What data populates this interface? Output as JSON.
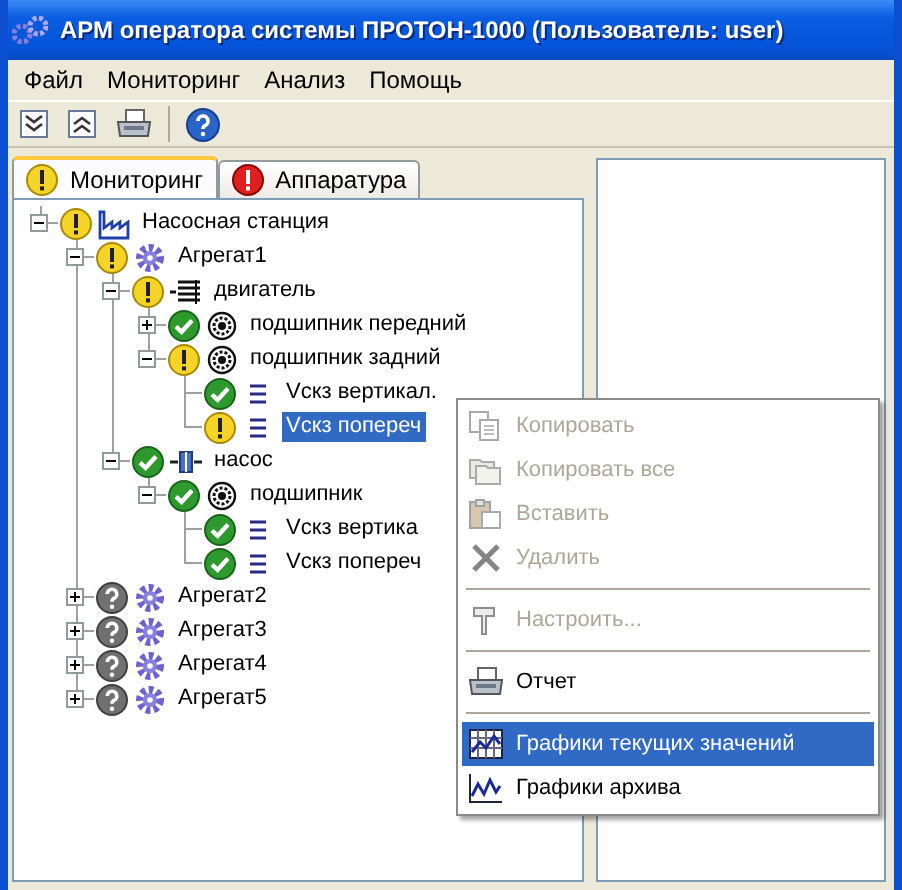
{
  "window": {
    "title": "АРМ оператора системы ПРОТОН-1000  (Пользователь: user)"
  },
  "menu": [
    "Файл",
    "Мониторинг",
    "Анализ",
    "Помощь"
  ],
  "tabs": [
    {
      "label": "Мониторинг",
      "badge": {
        "kind": "warning"
      },
      "selected": true
    },
    {
      "label": "Аппаратура",
      "badge": {
        "kind": "error"
      },
      "selected": false
    }
  ],
  "tree": {
    "items": [
      {
        "label": "Насосная станция",
        "status": {
          "kind": "warning"
        },
        "kind": "station",
        "expanded": true,
        "selected": false,
        "children": [
          {
            "label": "Агрегат1",
            "status": {
              "kind": "warning"
            },
            "kind": "unit",
            "expanded": true,
            "selected": false,
            "children": [
              {
                "label": "двигатель",
                "status": {
                  "kind": "warning"
                },
                "kind": "motor",
                "expanded": true,
                "selected": false,
                "children": [
                  {
                    "label": "подшипник передний",
                    "status": {
                      "kind": "ok"
                    },
                    "kind": "bearing",
                    "expanded": false,
                    "selected": false
                  },
                  {
                    "label": "подшипник задний",
                    "status": {
                      "kind": "warning"
                    },
                    "kind": "bearing",
                    "expanded": true,
                    "selected": false,
                    "children": [
                      {
                        "label": "Vскз вертикал.",
                        "status": {
                          "kind": "ok"
                        },
                        "kind": "sensor",
                        "selected": false
                      },
                      {
                        "label": "Vскз попереч",
                        "status": {
                          "kind": "warning"
                        },
                        "kind": "sensor",
                        "selected": true
                      }
                    ]
                  }
                ]
              },
              {
                "label": "насос",
                "status": {
                  "kind": "ok"
                },
                "kind": "pump",
                "expanded": true,
                "selected": false,
                "children": [
                  {
                    "label": "подшипник",
                    "status": {
                      "kind": "ok"
                    },
                    "kind": "bearing",
                    "expanded": true,
                    "selected": false,
                    "children": [
                      {
                        "label": "Vскз вертика",
                        "status": {
                          "kind": "ok"
                        },
                        "kind": "sensor",
                        "selected": false
                      },
                      {
                        "label": "Vскз попереч",
                        "status": {
                          "kind": "ok"
                        },
                        "kind": "sensor",
                        "selected": false
                      }
                    ]
                  }
                ]
              }
            ]
          },
          {
            "label": "Агрегат2",
            "status": {
              "kind": "unknown"
            },
            "kind": "unit",
            "expanded": false,
            "selected": false
          },
          {
            "label": "Агрегат3",
            "status": {
              "kind": "unknown"
            },
            "kind": "unit",
            "expanded": false,
            "selected": false
          },
          {
            "label": "Агрегат4",
            "status": {
              "kind": "unknown"
            },
            "kind": "unit",
            "expanded": false,
            "selected": false
          },
          {
            "label": "Агрегат5",
            "status": {
              "kind": "unknown"
            },
            "kind": "unit",
            "expanded": false,
            "selected": false
          }
        ]
      }
    ]
  },
  "context_menu": [
    {
      "kind": "item",
      "label": "Копировать",
      "disabled": true,
      "selected": false
    },
    {
      "kind": "item",
      "label": "Копировать все",
      "disabled": true,
      "selected": false
    },
    {
      "kind": "item",
      "label": "Вставить",
      "disabled": true,
      "selected": false
    },
    {
      "kind": "item",
      "label": "Удалить",
      "disabled": true,
      "selected": false
    },
    {
      "kind": "separator"
    },
    {
      "kind": "item",
      "label": "Настроить...",
      "disabled": true,
      "selected": false
    },
    {
      "kind": "separator"
    },
    {
      "kind": "item",
      "label": "Отчет",
      "disabled": false,
      "selected": false
    },
    {
      "kind": "separator"
    },
    {
      "kind": "item",
      "label": "Графики текущих значений",
      "disabled": false,
      "selected": true
    },
    {
      "kind": "item",
      "label": "Графики архива",
      "disabled": false,
      "selected": false
    }
  ]
}
